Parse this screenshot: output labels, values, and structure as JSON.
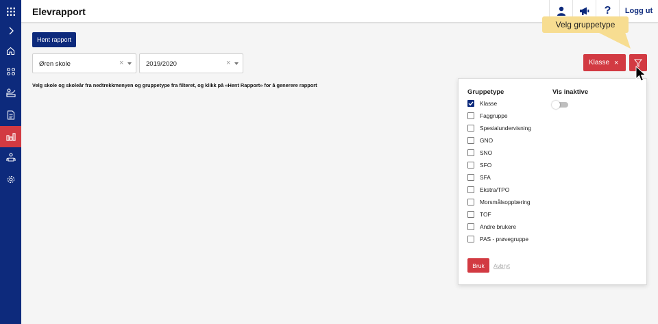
{
  "header": {
    "title": "Elevrapport",
    "logout_label": "Logg ut",
    "help_label": "?"
  },
  "sidebar": {
    "items": [
      {
        "icon": "grid-icon"
      },
      {
        "icon": "chevron-right-icon"
      },
      {
        "icon": "home-icon"
      },
      {
        "icon": "groups-icon"
      },
      {
        "icon": "teacher-icon"
      },
      {
        "icon": "document-icon"
      },
      {
        "icon": "report-chart-icon",
        "active": true
      },
      {
        "icon": "students-icon"
      },
      {
        "icon": "gear-icon"
      }
    ]
  },
  "main": {
    "fetch_button": "Hent rapport",
    "school_select": {
      "value": "Øren skole",
      "clear": "×"
    },
    "year_select": {
      "value": "2019/2020",
      "clear": "×"
    },
    "hint": "Velg skole og skoleår fra nedtrekkmenyen og gruppetype fra filteret, og klikk på «Hent Rapport» for å generere rapport",
    "active_filter_chip": "Klasse",
    "chip_close": "×"
  },
  "tooltip": {
    "text": "Velg gruppetype"
  },
  "filter_panel": {
    "group_type_heading": "Gruppetype",
    "show_inactive_heading": "Vis inaktive",
    "show_inactive_on": false,
    "options": [
      {
        "label": "Klasse",
        "checked": true
      },
      {
        "label": "Faggruppe",
        "checked": false
      },
      {
        "label": "Spesialundervisning",
        "checked": false
      },
      {
        "label": "GNO",
        "checked": false
      },
      {
        "label": "SNO",
        "checked": false
      },
      {
        "label": "SFO",
        "checked": false
      },
      {
        "label": "SFA",
        "checked": false
      },
      {
        "label": "Ekstra/TPO",
        "checked": false
      },
      {
        "label": "Morsmålsopplæring",
        "checked": false
      },
      {
        "label": "TOF",
        "checked": false
      },
      {
        "label": "Andre brukere",
        "checked": false
      },
      {
        "label": "PAS - prøvegruppe",
        "checked": false
      }
    ],
    "apply_label": "Bruk",
    "cancel_label": "Avbryt"
  },
  "colors": {
    "navy": "#0d2a7c",
    "red": "#d23a42",
    "tooltip": "#f7dd91"
  }
}
